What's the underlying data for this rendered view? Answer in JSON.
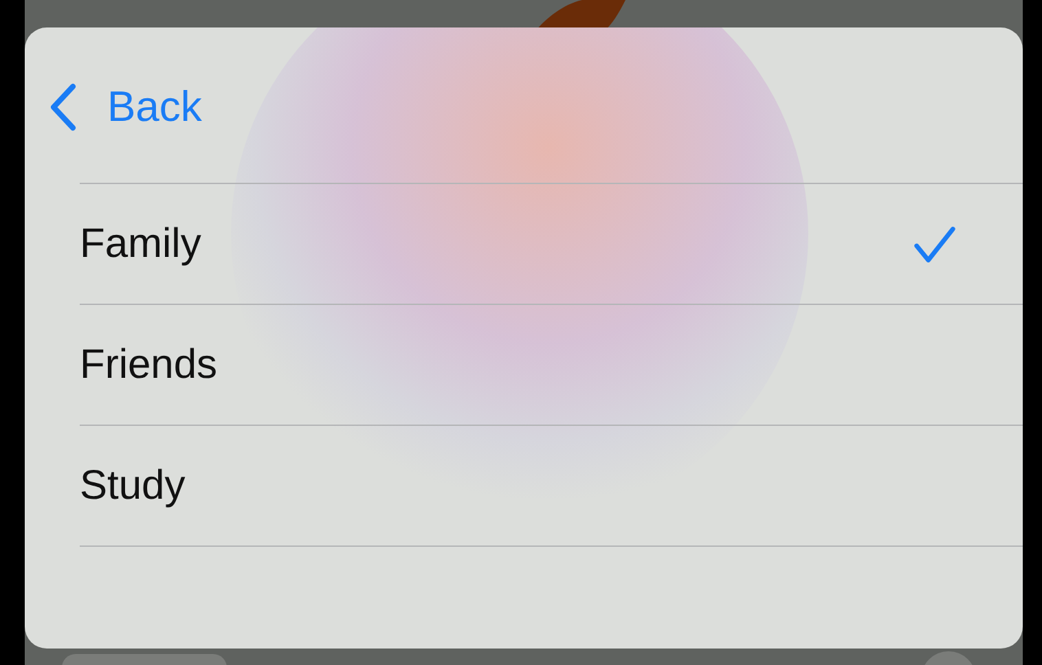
{
  "back_button": {
    "label": "Back"
  },
  "options": [
    {
      "label": "Family",
      "selected": true
    },
    {
      "label": "Friends",
      "selected": false
    },
    {
      "label": "Study",
      "selected": false
    }
  ]
}
